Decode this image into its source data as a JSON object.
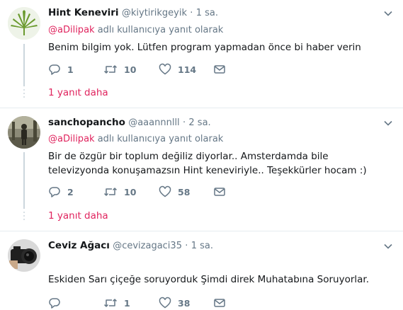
{
  "tweets": [
    {
      "name": "Hint Keneviri",
      "handle": "@kiytirikgeyik",
      "time": "1 sa.",
      "reply_prefix": "@aDilipak",
      "reply_suffix": " adlı kullanıcıya yanıt olarak",
      "text": "Benim bilgim yok. Lütfen program yapmadan önce bi haber verin",
      "replies": "1",
      "retweets": "10",
      "likes": "114",
      "more_replies": "1 yanıt daha",
      "avatar_icon": "cannabis-leaf-icon"
    },
    {
      "name": "sanchopancho",
      "handle": "@aaannnlll",
      "time": "2 sa.",
      "reply_prefix": "@aDilipak",
      "reply_suffix": " adlı kullanıcıya yanıt olarak",
      "text": "Bir de özgür bir toplum değiliz diyorlar.. Amsterdamda bile televizyonda konuşamazsın Hint keneviriyle.. Teşekkürler hocam :)",
      "replies": "2",
      "retweets": "10",
      "likes": "58",
      "more_replies": "1 yanıt daha",
      "avatar_icon": "person-photo-icon"
    },
    {
      "name": "Ceviz Ağacı",
      "handle": "@cevizagaci35",
      "time": "1 sa.",
      "reply_prefix": "",
      "reply_suffix": "",
      "text": "Eskiden Sarı çiçeğe soruyorduk Şimdi direk Muhatabına Soruyorlar.",
      "replies": "",
      "retweets": "1",
      "likes": "38",
      "avatar_icon": "camera-photo-icon"
    }
  ],
  "colors": {
    "accent": "#e0245e",
    "muted": "#657786",
    "line": "#ccd6dd",
    "separator": "#e6ecf0"
  }
}
